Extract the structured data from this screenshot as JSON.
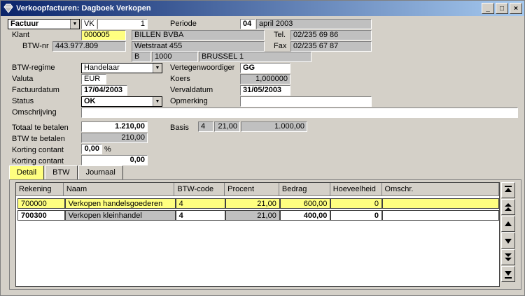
{
  "window": {
    "title": "Verkoopfacturen: Dagboek Verkopen",
    "controls": [
      "_",
      "□",
      "×"
    ]
  },
  "header": {
    "doc_type": "Factuur",
    "journal": "VK",
    "number": "1",
    "periode_label": "Periode",
    "periode_num": "04",
    "periode_text": "april 2003"
  },
  "klant": {
    "label": "Klant",
    "code": "000005",
    "name": "BILLEN BVBA",
    "tel_label": "Tel.",
    "tel": "02/235 69 86",
    "btw_label": "BTW-nr",
    "btw_nr": "443.977.809",
    "street": "Wetstraat 455",
    "fax_label": "Fax",
    "fax": "02/235 67 87",
    "country": "B",
    "zip": "1000",
    "city": "BRUSSEL 1"
  },
  "details": {
    "btw_regime_label": "BTW-regime",
    "btw_regime": "Handelaar",
    "vertegenwoordiger_label": "Vertegenwoordiger",
    "vertegenwoordiger": "GG",
    "valuta_label": "Valuta",
    "valuta": "EUR",
    "koers_label": "Koers",
    "koers": "1,000000",
    "factuurdatum_label": "Factuurdatum",
    "factuurdatum": "17/04/2003",
    "vervaldatum_label": "Vervaldatum",
    "vervaldatum": "31/05/2003",
    "status_label": "Status",
    "status": "OK",
    "opmerking_label": "Opmerking",
    "opmerking": "",
    "omschrijving_label": "Omschrijving",
    "omschrijving": ""
  },
  "totals": {
    "totaal_label": "Totaal te betalen",
    "totaal": "1.210,00",
    "btw_label": "BTW te betalen",
    "btw": "210,00",
    "korting_pct_label": "Korting contant",
    "korting_pct": "0,00",
    "pct_sign": "%",
    "korting_label": "Korting contant",
    "korting": "0,00",
    "basis_label": "Basis",
    "basis_code": "4",
    "basis_pct": "21,00",
    "basis_amount": "1.000,00"
  },
  "tabs": [
    "Detail",
    "BTW",
    "Journaal"
  ],
  "grid": {
    "columns": [
      "Rekening",
      "Naam",
      "BTW-code",
      "Procent",
      "Bedrag",
      "Hoeveelheid",
      "Omschr."
    ],
    "rows": [
      {
        "rekening": "700000",
        "naam": "Verkopen handelsgoederen",
        "btw_code": "4",
        "procent": "21,00",
        "bedrag": "600,00",
        "hoeveelheid": "0",
        "omschr": ""
      },
      {
        "rekening": "700300",
        "naam": "Verkopen kleinhandel",
        "btw_code": "4",
        "procent": "21,00",
        "bedrag": "400,00",
        "hoeveelheid": "0",
        "omschr": ""
      }
    ]
  },
  "colors": {
    "title_start": "#0a246a",
    "title_end": "#a6caf0",
    "highlight": "#ffff80",
    "readonly": "#c0c0c0"
  },
  "icons": [
    "app-icon",
    "minimize-icon",
    "maximize-icon",
    "close-icon",
    "first-record-icon",
    "page-up-icon",
    "previous-record-icon",
    "next-record-icon",
    "page-down-icon",
    "last-record-icon"
  ]
}
